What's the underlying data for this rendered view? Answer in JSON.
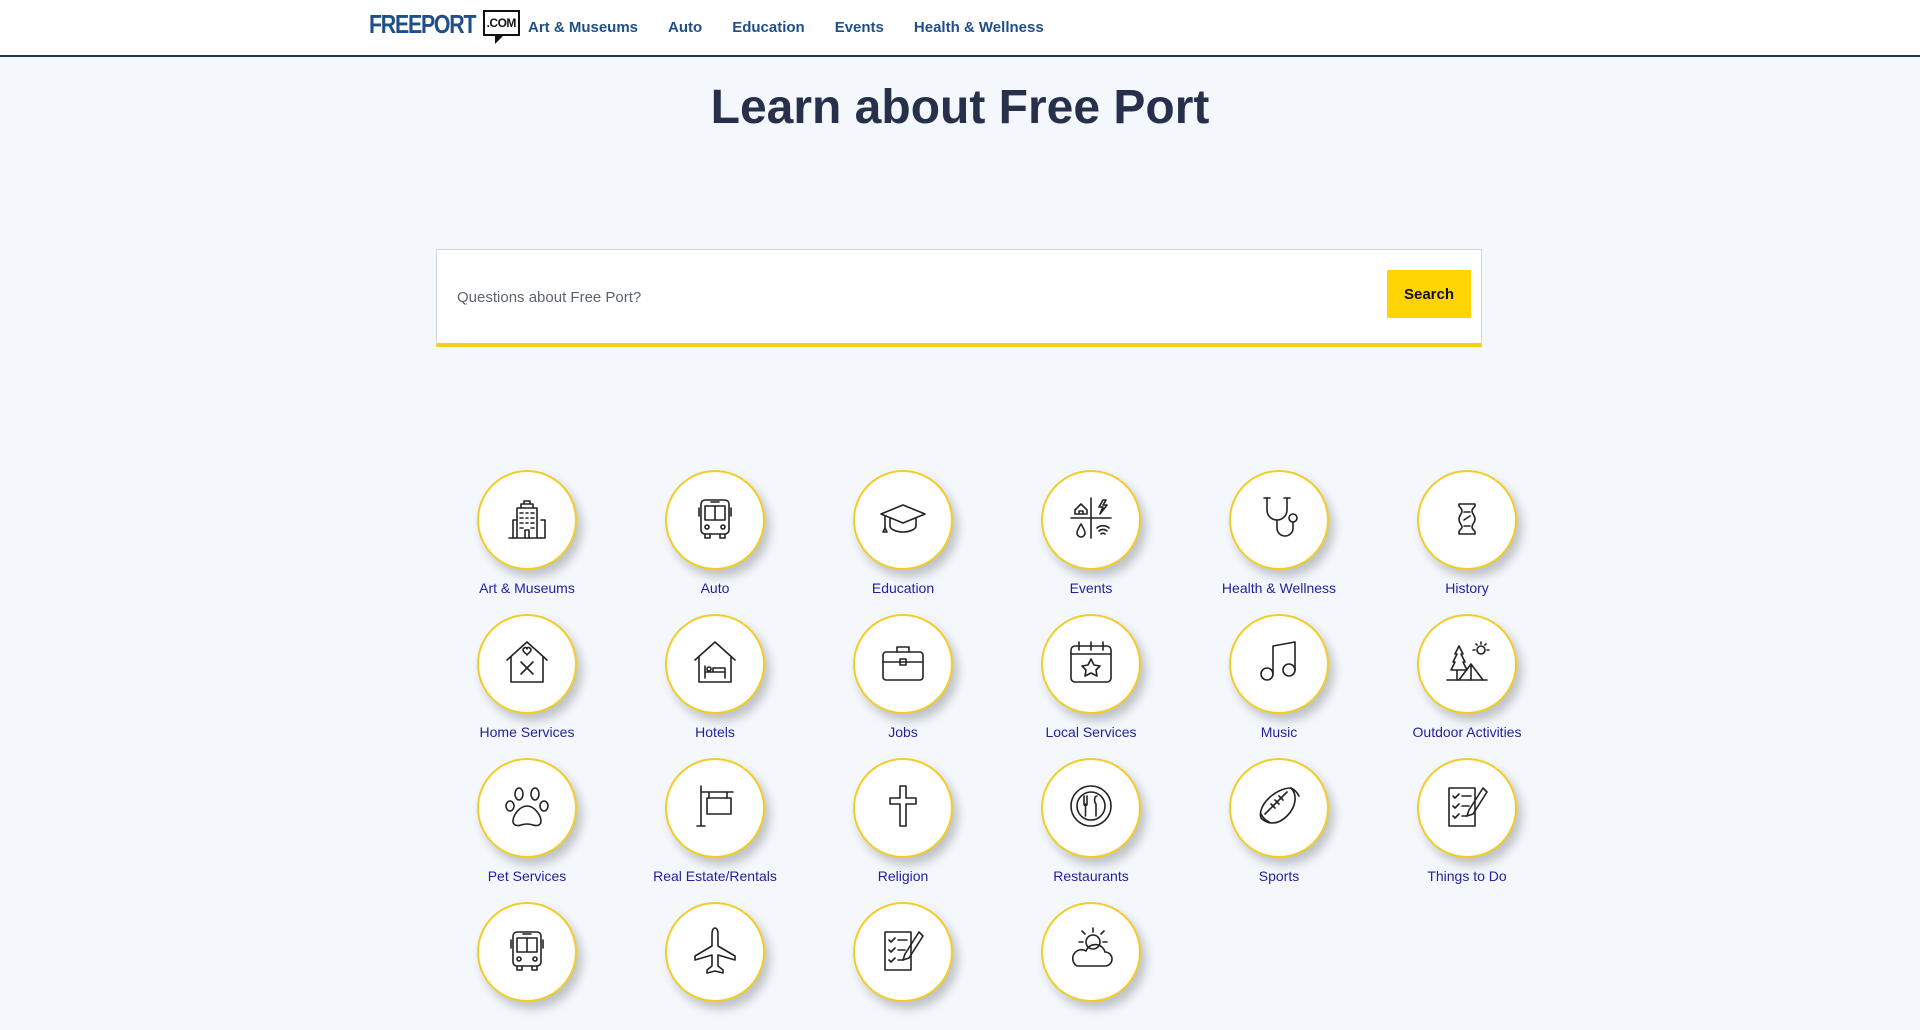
{
  "header": {
    "logo_main": "FREEPORT",
    "logo_suffix": ".COM",
    "nav": [
      "Art & Museums",
      "Auto",
      "Education",
      "Events",
      "Health & Wellness"
    ]
  },
  "hero": {
    "title": "Learn about Free Port"
  },
  "search": {
    "placeholder": "Questions about Free Port?",
    "button": "Search"
  },
  "categories": [
    {
      "label": "Art & Museums",
      "icon": "building-icon"
    },
    {
      "label": "Auto",
      "icon": "bus-icon"
    },
    {
      "label": "Education",
      "icon": "graduation-cap-icon"
    },
    {
      "label": "Events",
      "icon": "utilities-icon"
    },
    {
      "label": "Health & Wellness",
      "icon": "stethoscope-icon"
    },
    {
      "label": "History",
      "icon": "scroll-icon"
    },
    {
      "label": "Home Services",
      "icon": "house-tools-icon"
    },
    {
      "label": "Hotels",
      "icon": "house-bed-icon"
    },
    {
      "label": "Jobs",
      "icon": "briefcase-icon"
    },
    {
      "label": "Local Services",
      "icon": "calendar-star-icon"
    },
    {
      "label": "Music",
      "icon": "music-note-icon"
    },
    {
      "label": "Outdoor Activities",
      "icon": "camping-icon"
    },
    {
      "label": "Pet Services",
      "icon": "paw-icon"
    },
    {
      "label": "Real Estate/Rentals",
      "icon": "sign-post-icon"
    },
    {
      "label": "Religion",
      "icon": "cross-icon"
    },
    {
      "label": "Restaurants",
      "icon": "plate-cutlery-icon"
    },
    {
      "label": "Sports",
      "icon": "football-icon"
    },
    {
      "label": "Things to Do",
      "icon": "checklist-icon"
    },
    {
      "label": "",
      "icon": "bus-icon"
    },
    {
      "label": "",
      "icon": "airplane-icon"
    },
    {
      "label": "",
      "icon": "checklist-icon"
    },
    {
      "label": "",
      "icon": "weather-icon"
    }
  ],
  "colors": {
    "accent": "#ffd400",
    "nav": "#1f4f86",
    "label": "#1f1fa0",
    "background": "#f4f8fc"
  }
}
